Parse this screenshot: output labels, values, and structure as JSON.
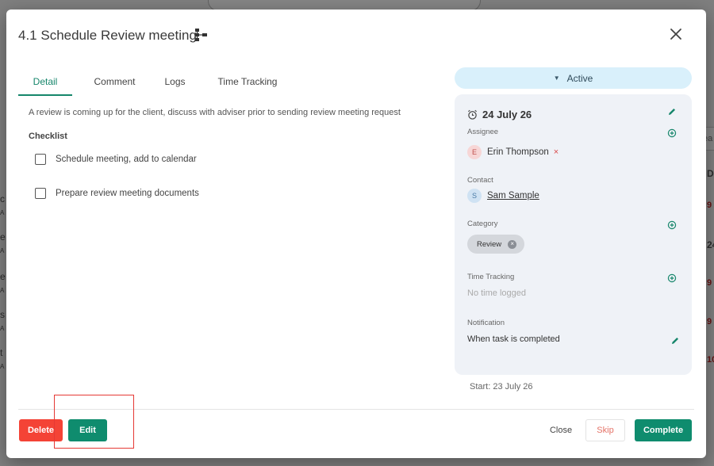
{
  "background": {
    "fragments": [
      "c",
      "A",
      "e",
      "A",
      "e",
      "A",
      "s",
      "A",
      "t",
      "A"
    ],
    "right_frags": [
      "ea",
      "Du",
      "9",
      "24",
      "9",
      "9",
      "10"
    ]
  },
  "modal": {
    "title": "4.1 Schedule Review meeting",
    "tabs": [
      {
        "label": "Detail",
        "active": true
      },
      {
        "label": "Comment",
        "active": false
      },
      {
        "label": "Logs",
        "active": false
      },
      {
        "label": "Time Tracking",
        "active": false
      }
    ],
    "description": "A review is coming up for the client, discuss with adviser prior to sending review meeting request",
    "checklist": {
      "title": "Checklist",
      "items": [
        {
          "label": "Schedule meeting, add to calendar",
          "checked": false
        },
        {
          "label": "Prepare review meeting documents",
          "checked": false
        }
      ]
    }
  },
  "side": {
    "status": "Active",
    "due_date": "24 July 26",
    "assignee": {
      "label": "Assignee",
      "initial": "E",
      "name": "Erin Thompson",
      "remove": "×"
    },
    "contact": {
      "label": "Contact",
      "initial": "S",
      "name": "Sam Sample"
    },
    "category": {
      "label": "Category",
      "value": "Review",
      "remove": "×"
    },
    "time_tracking": {
      "label": "Time Tracking",
      "value": "No time logged"
    },
    "notification": {
      "label": "Notification",
      "value": "When task is completed"
    },
    "start": "Start: 23 July 26"
  },
  "footer": {
    "delete": "Delete",
    "edit": "Edit",
    "close": "Close",
    "skip": "Skip",
    "complete": "Complete"
  },
  "colors": {
    "accent": "#0f8c6e",
    "danger": "#f44336",
    "status_bg": "#d9f0fb",
    "card_bg": "#eff2f7"
  }
}
